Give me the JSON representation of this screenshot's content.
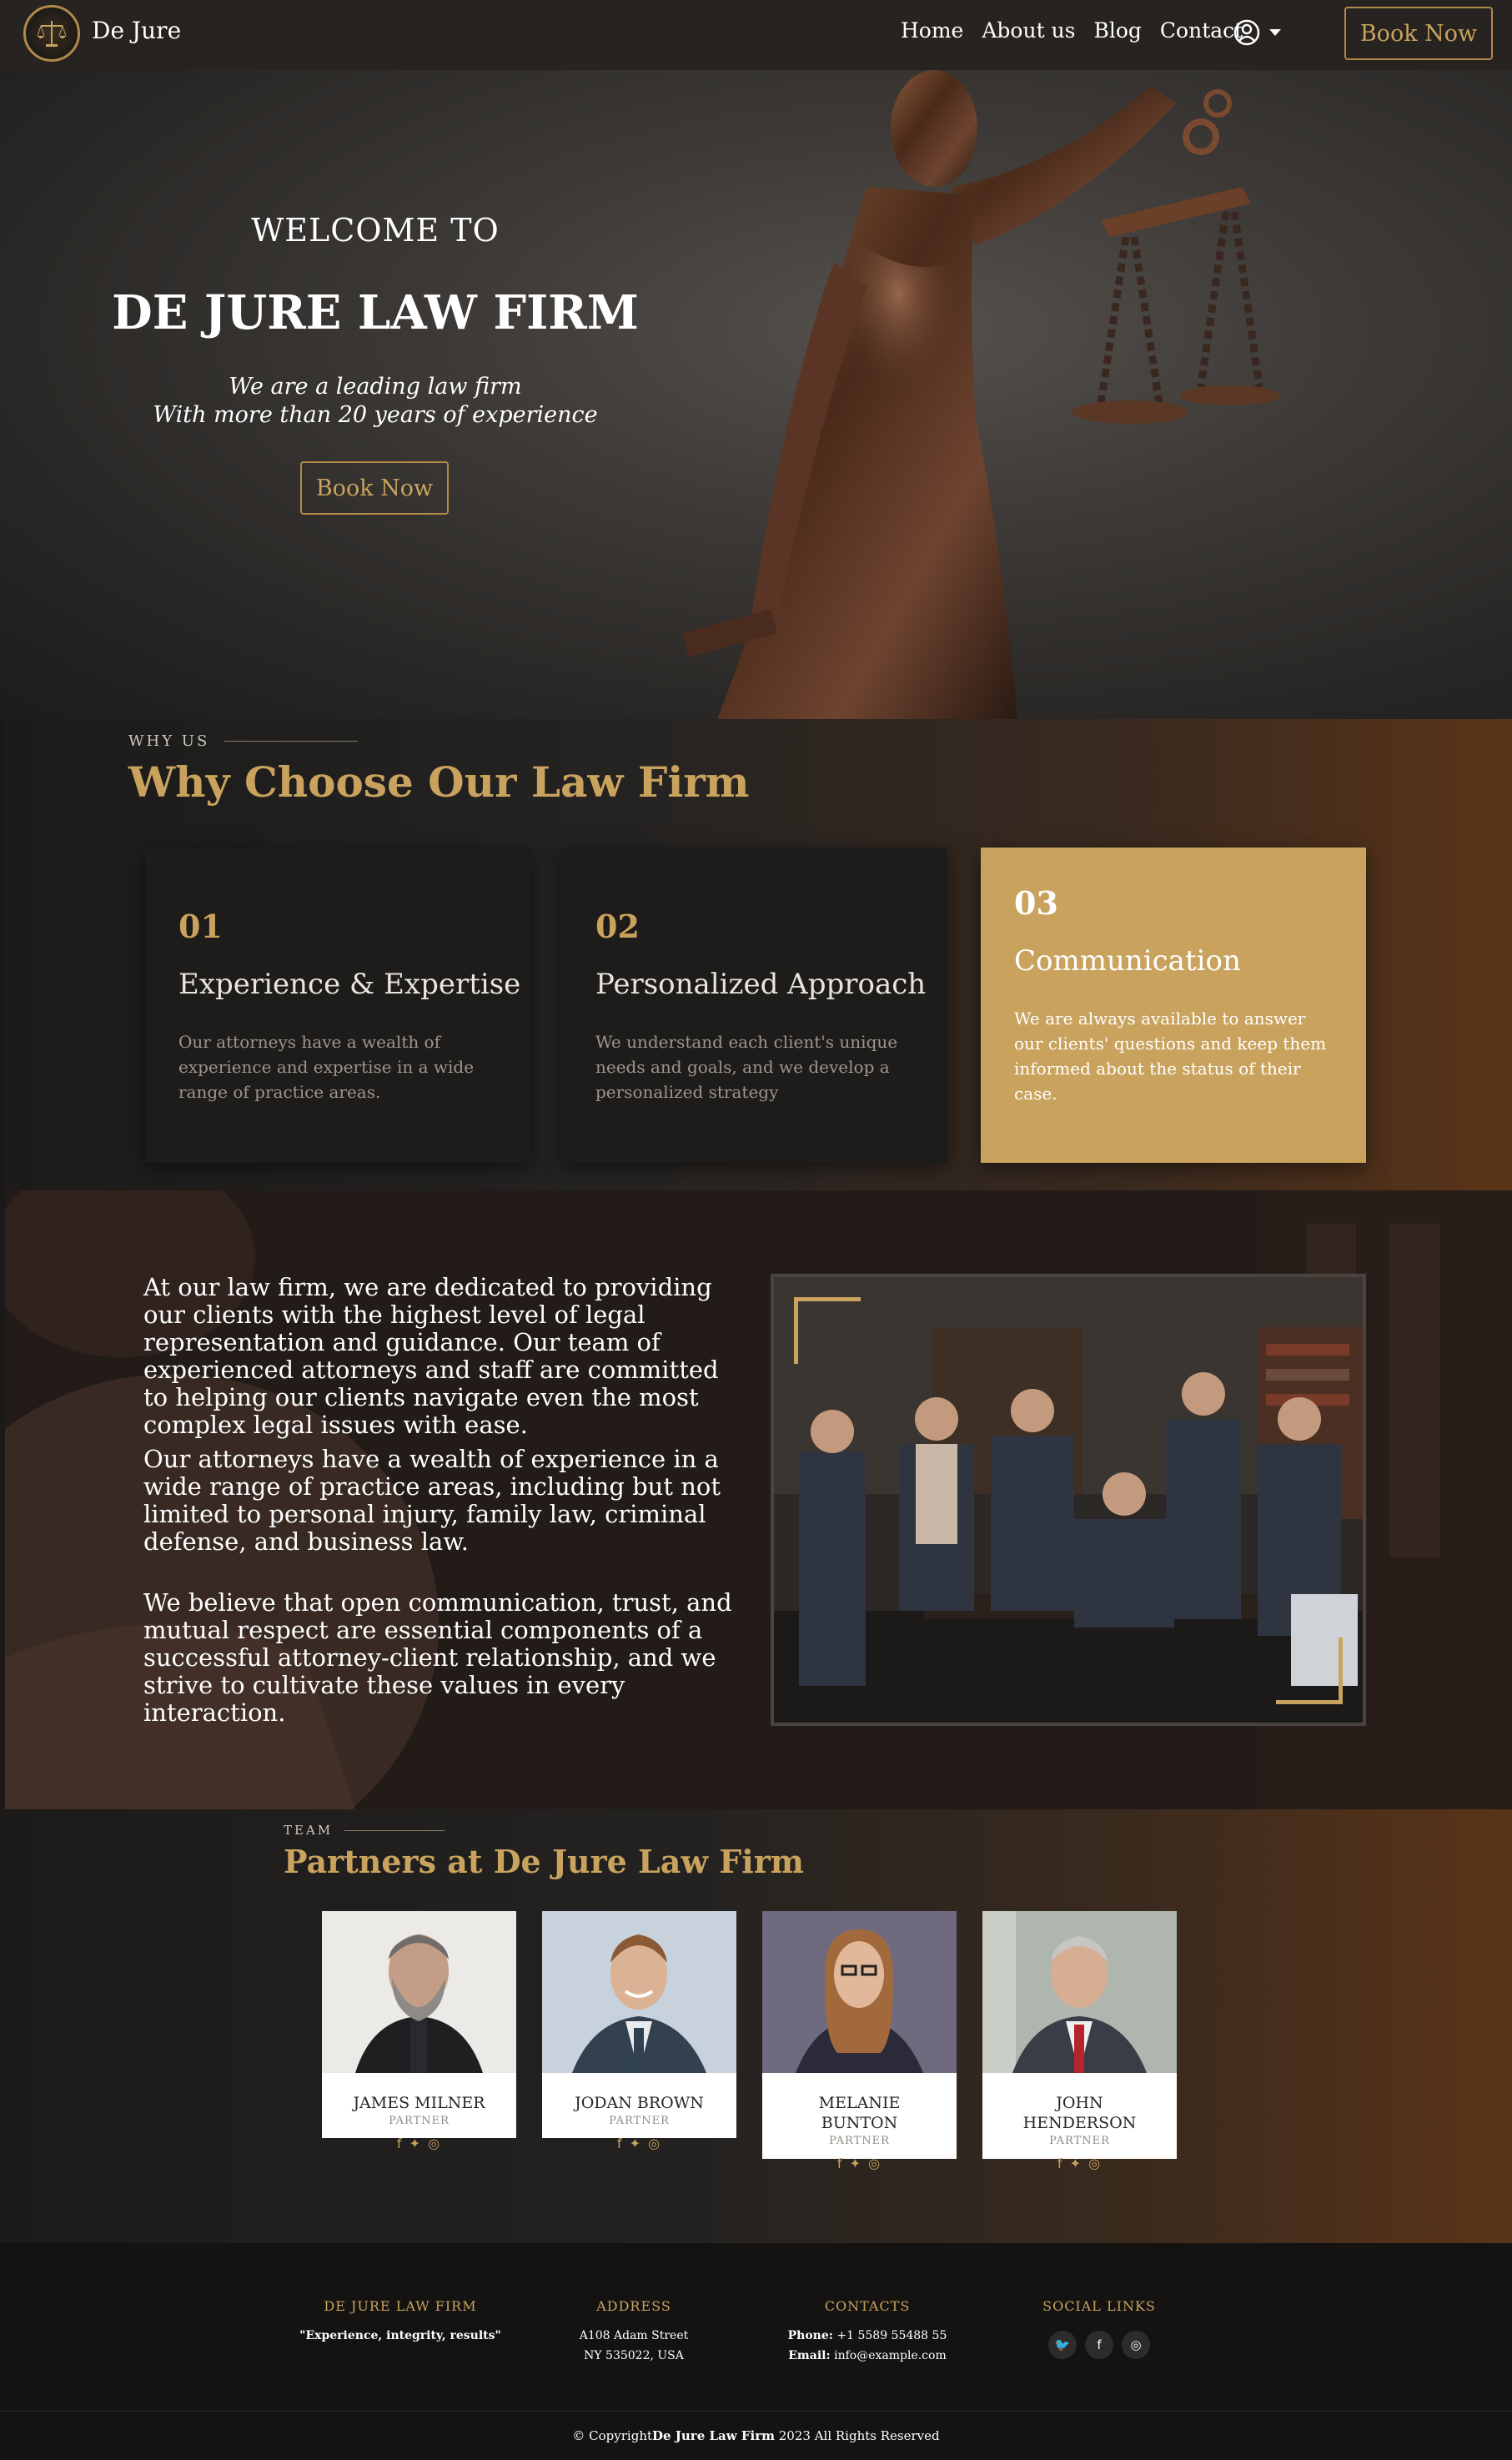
{
  "nav": {
    "brand": "De Jure",
    "links": [
      "Home",
      "About us",
      "Blog",
      "Contact"
    ],
    "book_label": "Book Now"
  },
  "hero": {
    "welcome": "WELCOME TO",
    "title": "DE JURE LAW FIRM",
    "subtitle_line1": "We are a leading law firm",
    "subtitle_line2": "With more than 20 years of experience",
    "book_label": "Book Now"
  },
  "why": {
    "eyebrow": "WHY US",
    "title": "Why Choose Our Law Firm",
    "cards": [
      {
        "num": "01",
        "title": "Experience & Expertise",
        "text": "Our attorneys have a wealth of experience and expertise in a wide range of practice areas."
      },
      {
        "num": "02",
        "title": "Personalized Approach",
        "text": "We understand each client's unique needs and goals, and we develop a personalized strategy"
      },
      {
        "num": "03",
        "title": "Communication",
        "text": "We are always available to answer our clients' questions and keep them informed about the status of their case."
      }
    ]
  },
  "about": {
    "p1": "At our law firm, we are dedicated to providing our clients with the highest level of legal representation and guidance. Our team of experienced attorneys and staff are committed to helping our clients navigate even the most complex legal issues with ease.",
    "p2": "Our attorneys have a wealth of experience in a wide range of practice areas, including but not limited to personal injury, family law, criminal defense, and business law.",
    "p3": "We believe that open communication, trust, and mutual respect are essential components of a successful attorney-client relationship, and we strive to cultivate these values in every interaction."
  },
  "partners": {
    "eyebrow": "TEAM",
    "title": "Partners at De Jure Law Firm",
    "people": [
      {
        "name": "JAMES MILNER",
        "role": "PARTNER"
      },
      {
        "name": "JODAN BROWN",
        "role": "PARTNER"
      },
      {
        "name": "MELANIE BUNTON",
        "role": "PARTNER"
      },
      {
        "name": "JOHN HENDERSON",
        "role": "PARTNER"
      }
    ],
    "social_icons": "f✓◎"
  },
  "footer": {
    "firm_head": "DE JURE LAW FIRM",
    "firm_motto": "\"Experience, integrity, results\"",
    "address_head": "ADDRESS",
    "address_line1": "A108 Adam Street",
    "address_line2": "NY 535022, USA",
    "contacts_head": "CONTACTS",
    "phone_label": "Phone:",
    "phone": "+1 5589 55488 55",
    "email_label": "Email:",
    "email": "info@example.com",
    "social_head": "SOCIAL LINKS",
    "copyright_prefix": "© Copyright",
    "copyright_brand": "De Jure Law Firm",
    "copyright_suffix": " 2023 All Rights Reserved"
  },
  "colors": {
    "accent": "#c9a35e",
    "nav_bg": "#262320",
    "card_bg": "#1e1c1a",
    "footer_bg": "#141312"
  }
}
